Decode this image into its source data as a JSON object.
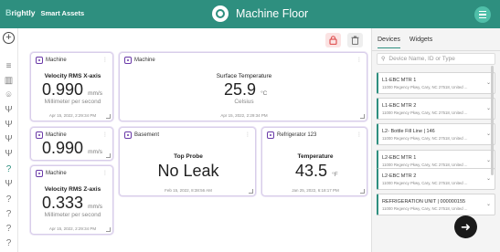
{
  "header": {
    "brand_b": "B",
    "brand_rest": "rightly",
    "product": "Smart Assets",
    "page_title": "Machine Floor",
    "menu_icon": "hamburger-icon"
  },
  "colors": {
    "accent": "#2e8f7f",
    "card_border": "#d8cdea",
    "card_icon": "#6a3aa8",
    "lock_bg": "#fbe3e3",
    "lock": "#e05555"
  },
  "widgets": [
    {
      "title": "Machine",
      "label": "Velocity RMS X-axis",
      "value": "0.990",
      "unit": "mm/s",
      "sub": "Millimeter per second",
      "ts": "Apr 15, 2022, 2:29:34 PM"
    },
    {
      "title": "Machine",
      "label": "Surface Temperature",
      "value": "25.9",
      "unit": "°C",
      "sub": "Celsius",
      "ts": "Apr 15, 2022, 2:29:34 PM"
    },
    {
      "title": "Machine",
      "value": "0.990",
      "unit": "mm/s"
    },
    {
      "title": "Basement",
      "label": "Top Probe",
      "value": "No Leak",
      "ts": "Feb 15, 2022, 8:38:56 AM"
    },
    {
      "title": "Refrigerator 123",
      "label": "Temperature",
      "value": "43.5",
      "unit": "°F",
      "ts": "Jan 25, 2022, 6:18:17 PM"
    },
    {
      "title": "Machine",
      "label": "Velocity RMS Z-axis",
      "value": "0.333",
      "unit": "mm/s",
      "sub": "Millimeter per second",
      "ts": "Apr 15, 2022, 2:29:34 PM"
    }
  ],
  "panel": {
    "tabs": [
      "Devices",
      "Widgets"
    ],
    "search_placeholder": "Device Name, ID or Type",
    "devices": [
      {
        "name": "L1-EBC MTR 1",
        "address": "11000 Regency Pkwy, Cary, NC 27518, United ..."
      },
      {
        "name": "L1-EBC MTR 2",
        "address": "11000 Regency Pkwy, Cary, NC 27518, United ..."
      },
      {
        "name": "L2- Bottle Fill Line | 146",
        "address": "11000 Regency Pkwy, Cary, NC 27518, United ..."
      },
      {
        "name": "L2-EBC MTR 1",
        "address": "11000 Regency Pkwy, Cary, NC 27518, United ..."
      },
      {
        "name": "L2-EBC MTR 2",
        "address": "11000 Regency Pkwy, Cary, NC 27518, United ..."
      },
      {
        "name": "REFRIGERATION UNIT | 000000155",
        "address": "11000 Regency Pkwy, Cary, NC 27518, United ..."
      }
    ]
  },
  "fab_icon": "arrow-right-icon"
}
